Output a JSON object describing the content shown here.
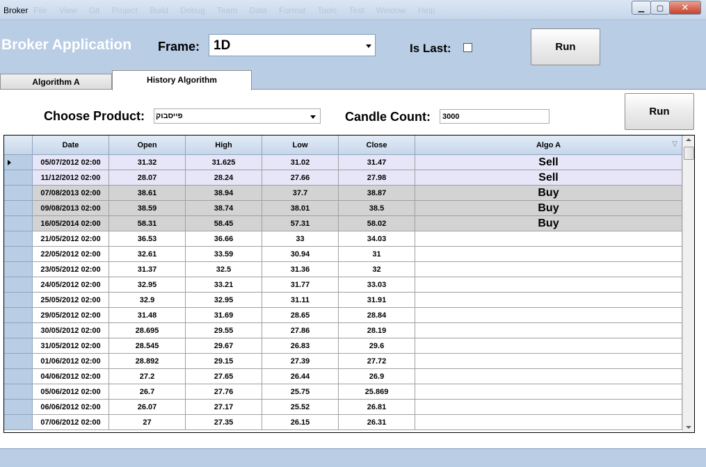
{
  "window": {
    "title": "Broker",
    "menu_ghost": [
      "File",
      "View",
      "Git",
      "Project",
      "Build",
      "Debug",
      "Team",
      "Data",
      "Format",
      "Tools",
      "Test",
      "Window",
      "Help"
    ],
    "minimize_glyph": "▁",
    "maximize_glyph": "▢",
    "close_glyph": "✕"
  },
  "header": {
    "app_title": "Broker Application",
    "frame_label": "Frame:",
    "frame_value": "1D",
    "is_last_label": "Is Last:",
    "is_last_checked": false,
    "run_label": "Run"
  },
  "tabs": [
    {
      "label": "Algorithm A",
      "active": false
    },
    {
      "label": "History Algorithm",
      "active": true
    }
  ],
  "history": {
    "product_label": "Choose Product:",
    "product_value": "פייסבוק",
    "candle_label": "Candle Count:",
    "candle_value": "3000",
    "run_label": "Run"
  },
  "grid": {
    "columns": [
      "Date",
      "Open",
      "High",
      "Low",
      "Close",
      "Algo A"
    ],
    "sort_glyph": "▽",
    "rows": [
      {
        "date": "05/07/2012 02:00",
        "open": "31.32",
        "high": "31.625",
        "low": "31.02",
        "close": "31.47",
        "algo": "Sell",
        "current": true
      },
      {
        "date": "11/12/2012 02:00",
        "open": "28.07",
        "high": "28.24",
        "low": "27.66",
        "close": "27.98",
        "algo": "Sell"
      },
      {
        "date": "07/08/2013 02:00",
        "open": "38.61",
        "high": "38.94",
        "low": "37.7",
        "close": "38.87",
        "algo": "Buy"
      },
      {
        "date": "09/08/2013 02:00",
        "open": "38.59",
        "high": "38.74",
        "low": "38.01",
        "close": "38.5",
        "algo": "Buy"
      },
      {
        "date": "16/05/2014 02:00",
        "open": "58.31",
        "high": "58.45",
        "low": "57.31",
        "close": "58.02",
        "algo": "Buy"
      },
      {
        "date": "21/05/2012 02:00",
        "open": "36.53",
        "high": "36.66",
        "low": "33",
        "close": "34.03",
        "algo": ""
      },
      {
        "date": "22/05/2012 02:00",
        "open": "32.61",
        "high": "33.59",
        "low": "30.94",
        "close": "31",
        "algo": ""
      },
      {
        "date": "23/05/2012 02:00",
        "open": "31.37",
        "high": "32.5",
        "low": "31.36",
        "close": "32",
        "algo": ""
      },
      {
        "date": "24/05/2012 02:00",
        "open": "32.95",
        "high": "33.21",
        "low": "31.77",
        "close": "33.03",
        "algo": ""
      },
      {
        "date": "25/05/2012 02:00",
        "open": "32.9",
        "high": "32.95",
        "low": "31.11",
        "close": "31.91",
        "algo": ""
      },
      {
        "date": "29/05/2012 02:00",
        "open": "31.48",
        "high": "31.69",
        "low": "28.65",
        "close": "28.84",
        "algo": ""
      },
      {
        "date": "30/05/2012 02:00",
        "open": "28.695",
        "high": "29.55",
        "low": "27.86",
        "close": "28.19",
        "algo": ""
      },
      {
        "date": "31/05/2012 02:00",
        "open": "28.545",
        "high": "29.67",
        "low": "26.83",
        "close": "29.6",
        "algo": ""
      },
      {
        "date": "01/06/2012 02:00",
        "open": "28.892",
        "high": "29.15",
        "low": "27.39",
        "close": "27.72",
        "algo": ""
      },
      {
        "date": "04/06/2012 02:00",
        "open": "27.2",
        "high": "27.65",
        "low": "26.44",
        "close": "26.9",
        "algo": ""
      },
      {
        "date": "05/06/2012 02:00",
        "open": "26.7",
        "high": "27.76",
        "low": "25.75",
        "close": "25.869",
        "algo": ""
      },
      {
        "date": "06/06/2012 02:00",
        "open": "26.07",
        "high": "27.17",
        "low": "25.52",
        "close": "26.81",
        "algo": ""
      },
      {
        "date": "07/06/2012 02:00",
        "open": "27",
        "high": "27.35",
        "low": "26.15",
        "close": "26.31",
        "algo": ""
      }
    ]
  }
}
